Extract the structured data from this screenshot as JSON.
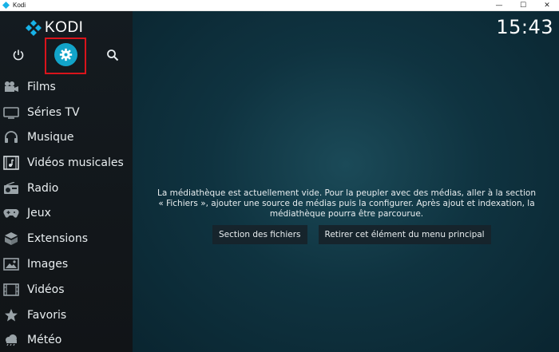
{
  "window": {
    "title": "Kodi",
    "controls": [
      "—",
      "☐",
      "✕"
    ]
  },
  "kodi": {
    "logo_text": "KODI",
    "clock": "15:43",
    "top_icons": [
      "power-icon",
      "gear-icon",
      "search-icon"
    ],
    "menu": [
      {
        "label": "Films",
        "icon": "film-camera-icon"
      },
      {
        "label": "Séries TV",
        "icon": "tv-icon"
      },
      {
        "label": "Musique",
        "icon": "headphones-icon"
      },
      {
        "label": "Vidéos musicales",
        "icon": "music-video-icon"
      },
      {
        "label": "Radio",
        "icon": "radio-icon"
      },
      {
        "label": "Jeux",
        "icon": "gamepad-icon"
      },
      {
        "label": "Extensions",
        "icon": "box-icon"
      },
      {
        "label": "Images",
        "icon": "image-icon"
      },
      {
        "label": "Vidéos",
        "icon": "filmstrip-icon"
      },
      {
        "label": "Favoris",
        "icon": "star-icon"
      },
      {
        "label": "Météo",
        "icon": "cloud-icon"
      }
    ],
    "empty_message": "La médiathèque est actuellement vide. Pour la peupler avec des médias, aller à la section « Fichiers », ajouter une source de médias puis la configurer. Après ajout et indexation, la médiathèque pourra être parcourue.",
    "buttons": {
      "files_section": "Section des fichiers",
      "remove_item": "Retirer cet élément du menu principal"
    }
  },
  "colors": {
    "accent": "#12a4c9",
    "highlight_box": "#d9141b",
    "logo_blue": "#17b2e7"
  }
}
